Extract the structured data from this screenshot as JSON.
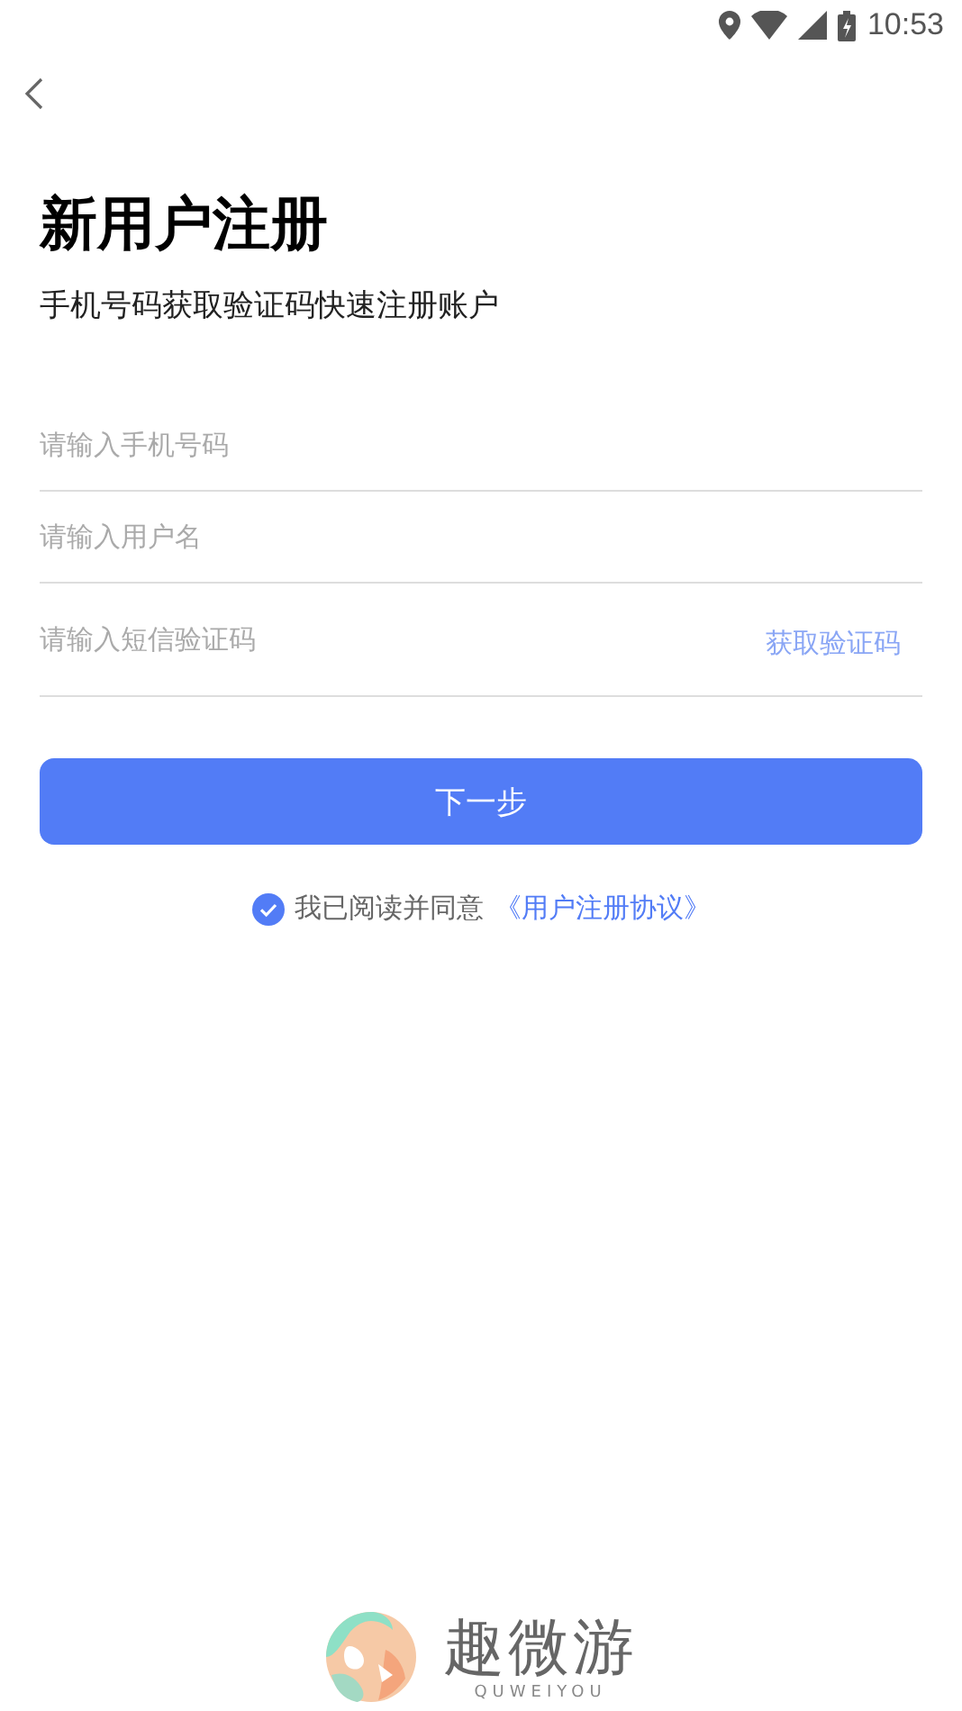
{
  "status_bar": {
    "time": "10:53"
  },
  "title": "新用户注册",
  "subtitle": "手机号码获取验证码快速注册账户",
  "fields": [
    {
      "placeholder": "请输入手机号码"
    },
    {
      "placeholder": "请输入用户名"
    },
    {
      "placeholder": "请输入短信验证码",
      "action": "获取验证码"
    }
  ],
  "next_button": "下一步",
  "agreement": {
    "checked": true,
    "text": "我已阅读并同意",
    "link": "《用户注册协议》"
  },
  "logo": {
    "name": "趣微游",
    "tagline": "QUWEIYOU"
  }
}
